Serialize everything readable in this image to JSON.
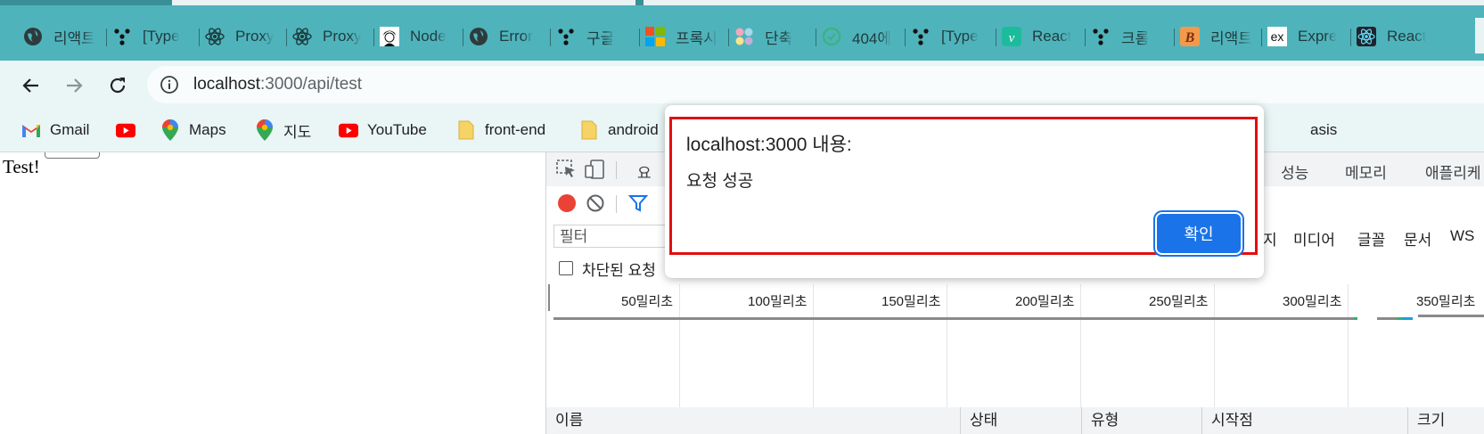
{
  "tabs": [
    {
      "label": "리액트",
      "icon": "globe-icon"
    },
    {
      "label": "[Type",
      "icon": "dots-tree-icon"
    },
    {
      "label": "Proxy",
      "icon": "react-icon"
    },
    {
      "label": "Proxy",
      "icon": "react-icon"
    },
    {
      "label": "Node",
      "icon": "avatar-icon"
    },
    {
      "label": "Error",
      "icon": "globe-icon"
    },
    {
      "label": "구글",
      "icon": "dots-tree-icon"
    },
    {
      "label": "프록시",
      "icon": "microsoft-icon"
    },
    {
      "label": "단축",
      "icon": "color-dots-icon"
    },
    {
      "label": "404에",
      "icon": "green-circle-icon"
    },
    {
      "label": "[Type",
      "icon": "dots-tree-icon"
    },
    {
      "label": "React",
      "icon": "v-icon"
    },
    {
      "label": "크롬",
      "icon": "dots-tree-icon"
    },
    {
      "label": "리액트",
      "icon": "b-icon"
    },
    {
      "label": "Expre",
      "icon": "ex-icon"
    },
    {
      "label": "React",
      "icon": "react-icon"
    }
  ],
  "toolbar": {
    "url_host": "localhost",
    "url_rest": ":3000/api/test"
  },
  "bookmarks": [
    {
      "label": "Gmail",
      "icon": "gmail-icon"
    },
    {
      "label": "",
      "icon": "youtube-icon"
    },
    {
      "label": "Maps",
      "icon": "maps-pin-icon"
    },
    {
      "label": "지도",
      "icon": "maps-pin-icon"
    },
    {
      "label": "YouTube",
      "icon": "youtube-icon"
    },
    {
      "label": "front-end",
      "icon": "folder-icon"
    },
    {
      "label": "android",
      "icon": "folder-icon"
    },
    {
      "label": "asis",
      "icon": ""
    }
  ],
  "page": {
    "body_text": "Test!"
  },
  "devtools": {
    "tabs": [
      "요",
      "성능",
      "메모리",
      "애플리케"
    ],
    "filter_placeholder": "필터",
    "filter_types": [
      "지",
      "미디어",
      "글꼴",
      "문서",
      "WS"
    ],
    "blocked_requests_label": "차단된 요청",
    "timeline_ticks": [
      "50밀리초",
      "100밀리초",
      "150밀리초",
      "200밀리초",
      "250밀리초",
      "300밀리초",
      "350밀리초"
    ],
    "columns": [
      "이름",
      "상태",
      "유형",
      "시작점",
      "크기"
    ]
  },
  "alert": {
    "title": "localhost:3000 내용:",
    "message": "요청 성공",
    "ok_label": "확인"
  },
  "colors": {
    "tabstrip": "#4fb3bb",
    "toolbar": "#eaf5f5",
    "accent": "#1a73e8",
    "alert_outline": "#e01010"
  }
}
